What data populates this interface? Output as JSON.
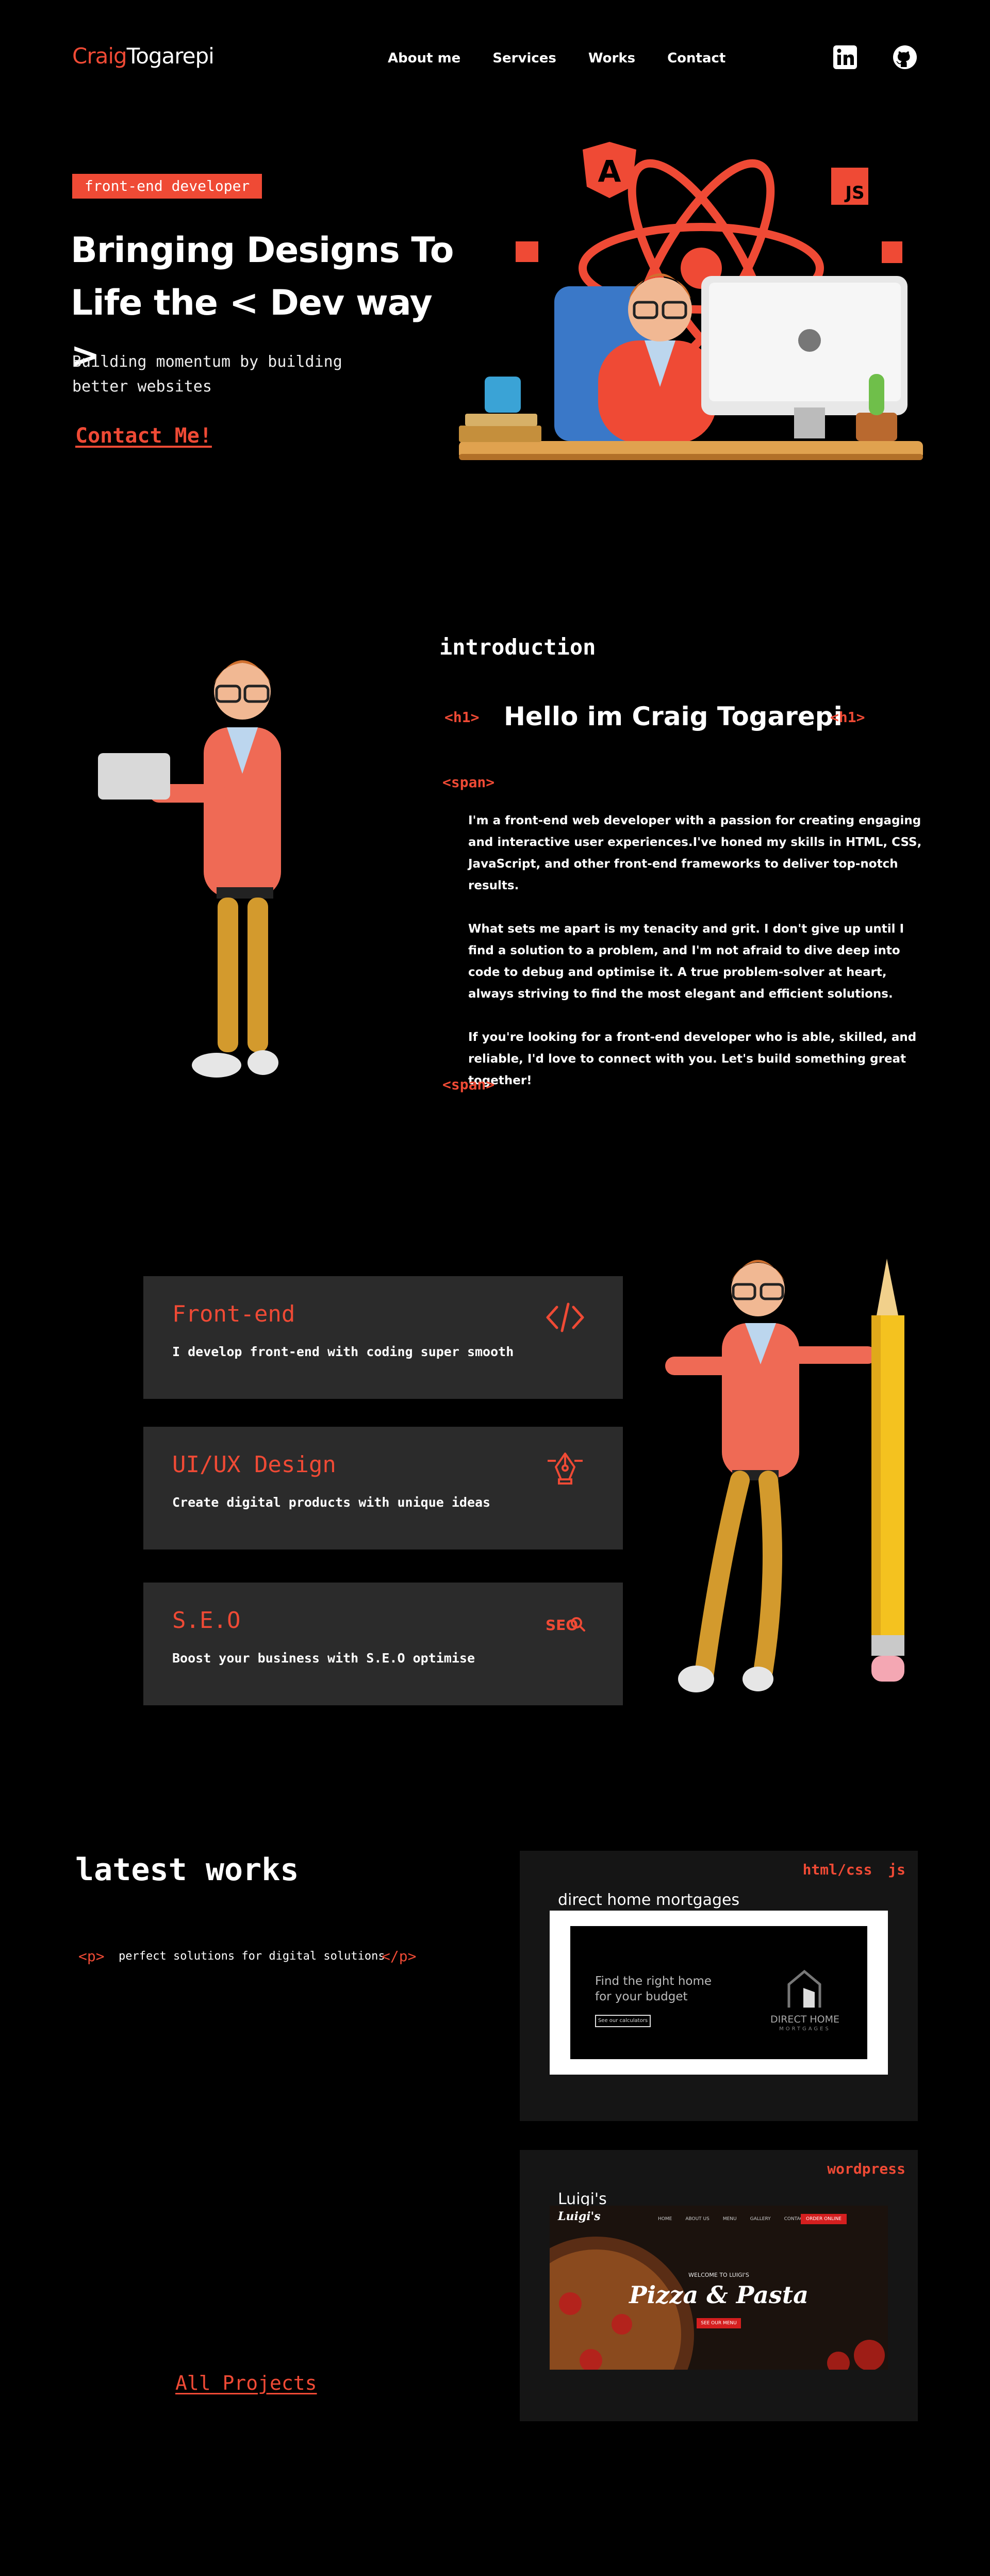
{
  "nav": {
    "logo_first": "Craig",
    "logo_last": "Togarepi",
    "links": [
      "About me",
      "Services",
      "Works",
      "Contact"
    ],
    "social_icons": [
      "linkedin-icon",
      "github-icon"
    ]
  },
  "hero": {
    "badge": "front-end developer",
    "title_line1": "Bringing Designs To",
    "title_line2": "Life the < Dev way >",
    "subtitle_line1": "Building momentum by building",
    "subtitle_line2": "better websites",
    "cta": "Contact Me!",
    "art_labels": {
      "angular": "A",
      "js": "JS"
    }
  },
  "intro": {
    "heading": "introduction",
    "h1_open": "<h1>",
    "h1_close": "<h1>",
    "hello": "Hello im Craig Togarepi",
    "span_open": "<span>",
    "span_close": "<span>",
    "paragraphs": [
      "I'm a front-end web developer with a passion for creating engaging and interactive user experiences.I've honed my skills in HTML, CSS, JavaScript, and other front-end frameworks to deliver top-notch results.",
      "What sets me apart is my tenacity and grit. I don't give up until I find a solution to a problem, and I'm not afraid to dive deep into code to debug and optimise it.  A true problem-solver at heart, always striving to find the most elegant and efficient solutions.",
      "If you're looking for a front-end developer who is able, skilled, and reliable, I'd love to connect with you. Let's build something great together!"
    ]
  },
  "services": [
    {
      "title": "Front-end",
      "desc": "I develop front-end with coding super smooth",
      "icon": "code-icon"
    },
    {
      "title": "UI/UX Design",
      "desc": "Create digital products with unique ideas",
      "icon": "pen-tool-icon"
    },
    {
      "title": "S.E.O",
      "desc": "Boost your business with S.E.O optimise",
      "icon": "seo-search-icon",
      "icon_text": "SEO"
    }
  ],
  "works": {
    "heading": "latest works",
    "p_open": "<p>",
    "p_text": "perfect solutions for digital solutions",
    "p_close": "</p>",
    "all_projects": "All Projects",
    "items": [
      {
        "tags": "html/css  js",
        "name": "direct home mortgages",
        "thumb_line1": "Find the right home",
        "thumb_line2": "for your budget",
        "thumb_button": "See our calculators",
        "thumb_brand": "DIRECT HOME",
        "thumb_brand_sub": "MORTGAGES"
      },
      {
        "tags": "wordpress",
        "name": "Luigi's",
        "thumb_logo": "Luigi's",
        "thumb_menu": [
          "HOME",
          "ABOUT US",
          "MENU",
          "GALLERY",
          "CONTACT"
        ],
        "thumb_order": "ORDER ONLINE",
        "thumb_welcome": "WELCOME TO LUIGI'S",
        "thumb_title": "Pizza & Pasta",
        "thumb_button": "SEE OUR MENU"
      }
    ]
  },
  "colors": {
    "accent": "#ef4a35",
    "background": "#000000",
    "card": "#2b2b2b",
    "panel": "#151515"
  }
}
